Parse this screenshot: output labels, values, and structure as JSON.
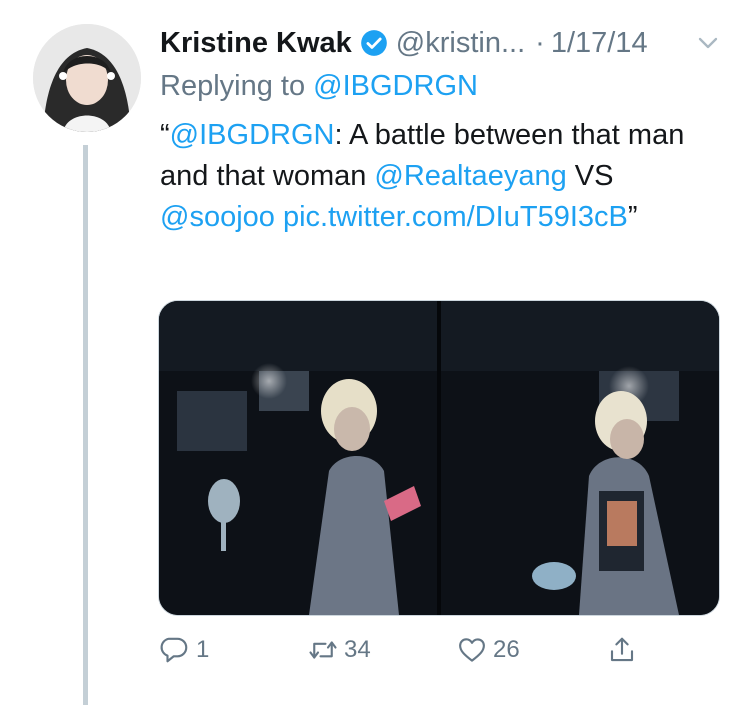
{
  "tweet": {
    "author_name": "Kristine Kwak",
    "handle": "@kristin...",
    "dot": "·",
    "date": "1/17/14",
    "replying_label": "Replying to",
    "replying_handle": "@IBGDRGN",
    "text_parts": [
      "“",
      "@IBGDRGN",
      ": A battle between that man and that woman ",
      "@Realtaeyang",
      " VS ",
      "@soojoo",
      " ",
      "pic.twitter.com/DIuT59I3cB",
      "”"
    ]
  },
  "actions": {
    "reply_count": "1",
    "retweet_count": "34",
    "like_count": "26"
  },
  "icons": {
    "verified": "verified-icon",
    "caret": "chevron-down-icon",
    "reply": "reply-icon",
    "retweet": "retweet-icon",
    "like": "heart-icon",
    "share": "share-icon"
  },
  "colors": {
    "link": "#1da1f2",
    "muted": "#657786",
    "text": "#14171a",
    "thread_line": "#c4cfd6"
  }
}
